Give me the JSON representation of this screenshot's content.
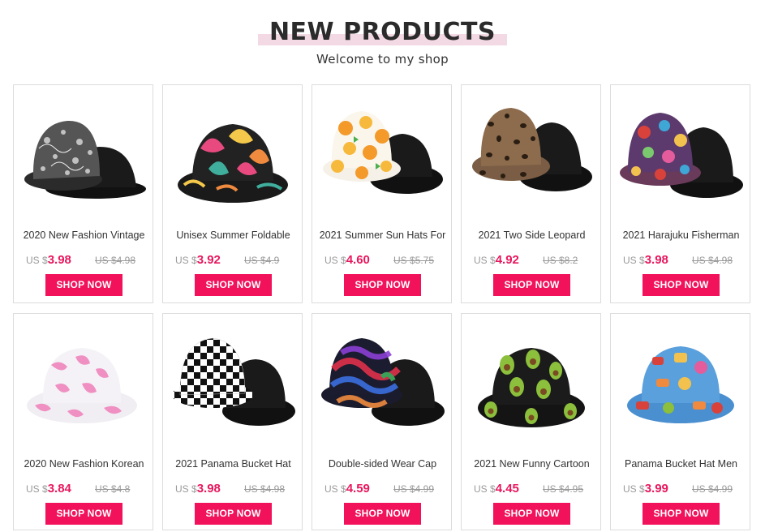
{
  "header": {
    "title": "NEW PRODUCTS",
    "subtitle": "Welcome to my shop"
  },
  "button_label": "SHOP NOW",
  "colors": {
    "accent": "#f2115b",
    "price": "#e8175d",
    "title_underline": "#f3d9e3"
  },
  "products": [
    {
      "name": "2020 New Fashion Vintage",
      "currency": "US $",
      "price": "3.98",
      "old_price": "US $4.98",
      "image": "paisley-bucket-hat"
    },
    {
      "name": "Unisex Summer Foldable",
      "currency": "US $",
      "price": "3.92",
      "old_price": "US $4.9",
      "image": "leaf-print-bucket-hat"
    },
    {
      "name": "2021 Summer Sun Hats For",
      "currency": "US $",
      "price": "4.60",
      "old_price": "US $5.75",
      "image": "orange-fruit-bucket-hat"
    },
    {
      "name": "2021 Two Side Leopard",
      "currency": "US $",
      "price": "4.92",
      "old_price": "US $8.2",
      "image": "leopard-bucket-hat"
    },
    {
      "name": "2021 Harajuku Fisherman",
      "currency": "US $",
      "price": "3.98",
      "old_price": "US $4.98",
      "image": "graffiti-bucket-hat"
    },
    {
      "name": "2020 New Fashion Korean",
      "currency": "US $",
      "price": "3.84",
      "old_price": "US $4.8",
      "image": "pink-cow-bucket-hat"
    },
    {
      "name": "2021 Panama Bucket Hat",
      "currency": "US $",
      "price": "3.98",
      "old_price": "US $4.98",
      "image": "checkered-bucket-hat"
    },
    {
      "name": "Double-sided Wear Cap",
      "currency": "US $",
      "price": "4.59",
      "old_price": "US $4.99",
      "image": "tie-dye-bucket-hat"
    },
    {
      "name": "2021 New Funny Cartoon",
      "currency": "US $",
      "price": "4.45",
      "old_price": "US $4.95",
      "image": "avocado-bucket-hat"
    },
    {
      "name": "Panama Bucket Hat Men",
      "currency": "US $",
      "price": "3.99",
      "old_price": "US $4.99",
      "image": "food-print-bucket-hat"
    }
  ]
}
